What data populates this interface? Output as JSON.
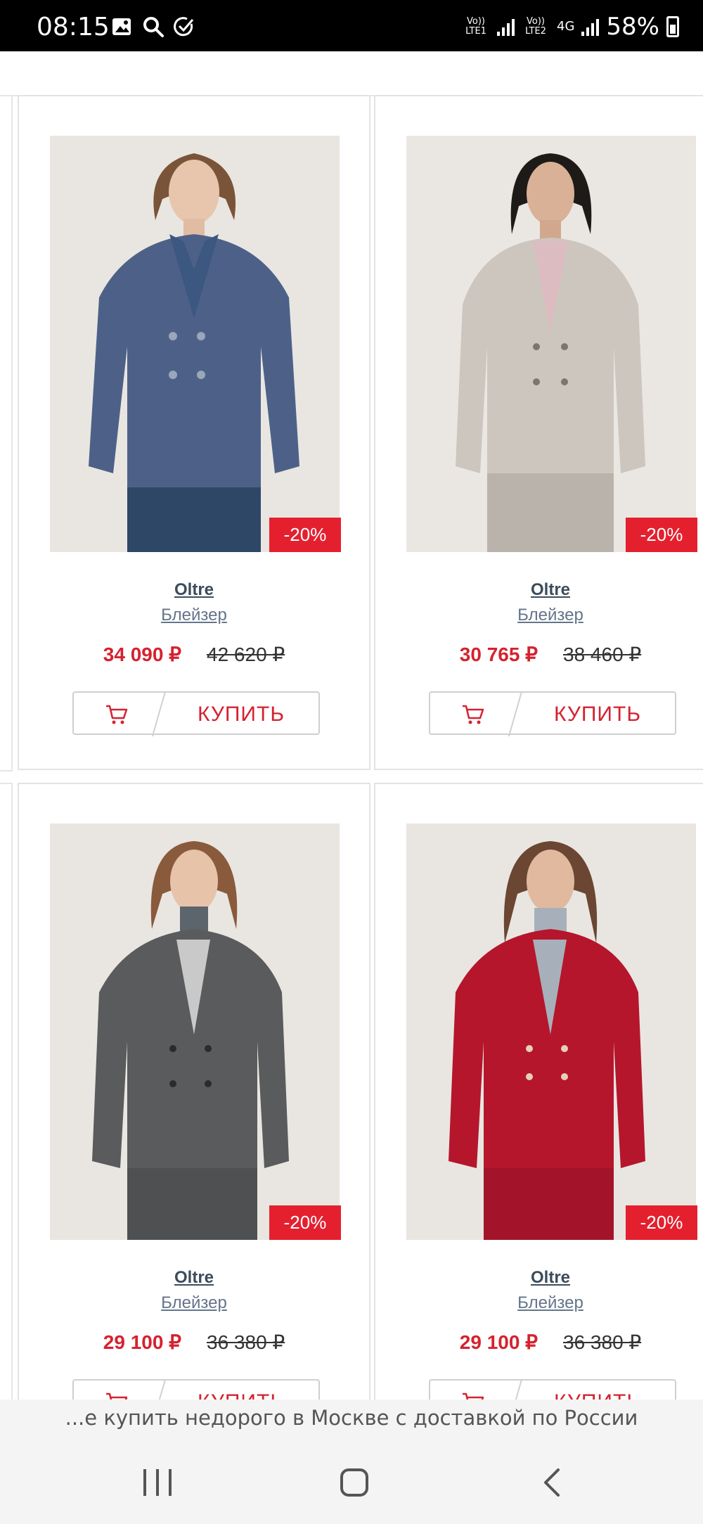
{
  "status_bar": {
    "time": "08:15",
    "sim1_label": "Vo)) LTE1",
    "sim2_label": "Vo)) LTE2",
    "network_type": "4G",
    "battery": "58%",
    "icons": [
      "gallery-icon",
      "search-icon",
      "check-circle-icon",
      "signal-icon",
      "battery-icon"
    ]
  },
  "products": [
    {
      "brand": "Oltre",
      "type": "Блейзер",
      "price_new": "34 090 ₽",
      "price_old": "42 620 ₽",
      "discount": "-20%",
      "buy_label": "КУПИТЬ",
      "image": "model-navy-pea-coat"
    },
    {
      "brand": "Oltre",
      "type": "Блейзер",
      "price_new": "30 765 ₽",
      "price_old": "38 460 ₽",
      "discount": "-20%",
      "buy_label": "КУПИТЬ",
      "image": "model-beige-blazer"
    },
    {
      "brand": "Oltre",
      "type": "Блейзер",
      "price_new": "29 100 ₽",
      "price_old": "36 380 ₽",
      "discount": "-20%",
      "buy_label": "КУПИТЬ",
      "image": "model-grey-check-blazer"
    },
    {
      "brand": "Oltre",
      "type": "Блейзер",
      "price_new": "29 100 ₽",
      "price_old": "36 380 ₽",
      "discount": "-20%",
      "buy_label": "КУПИТЬ",
      "image": "model-red-blazer"
    }
  ],
  "colors": {
    "accent_red": "#e4202f",
    "price_red": "#d5222f",
    "link_blue_grey": "#65758a"
  },
  "bottom_suggestion": "...е купить недорого в Москве с доставкой по России",
  "nav_bar": {
    "icons": [
      "recents-icon",
      "home-icon",
      "back-icon"
    ]
  }
}
